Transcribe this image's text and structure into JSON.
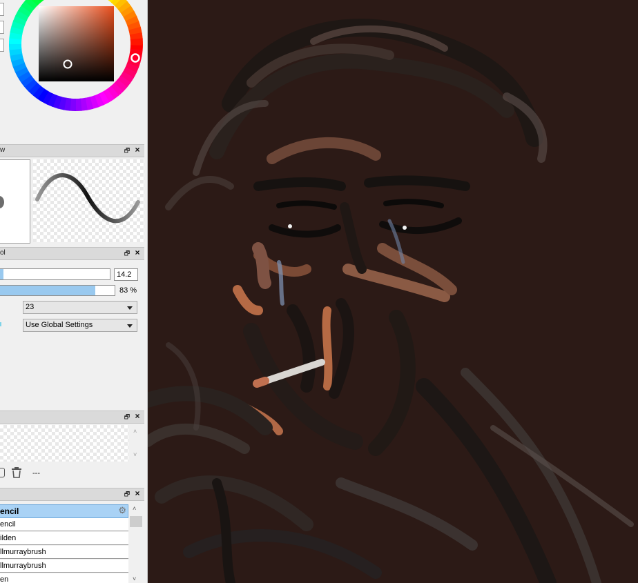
{
  "panel": {
    "brush_preview": {
      "title_partial": "w"
    },
    "tool_options": {
      "title_partial": "ol",
      "size_value": "14.2",
      "size_fill_fraction": 0.04,
      "opacity_value": "83 %",
      "opacity_fraction": 0.83,
      "smoothing_value": "23",
      "stabilizer_value": "Use Global Settings"
    },
    "layers": {
      "status_text": "---"
    },
    "presets": {
      "selected": "encil",
      "items": [
        "encil",
        "ilden",
        "llmurraybrush",
        "llmurraybrush",
        "en"
      ]
    }
  },
  "colors": {
    "panel_bg": "#f0f0f0",
    "selection_blue": "#a9d2f5",
    "slider_fill": "#99c9ef",
    "canvas_bg": "#2c1a16",
    "hue_ring_marker": "#ffffff"
  }
}
